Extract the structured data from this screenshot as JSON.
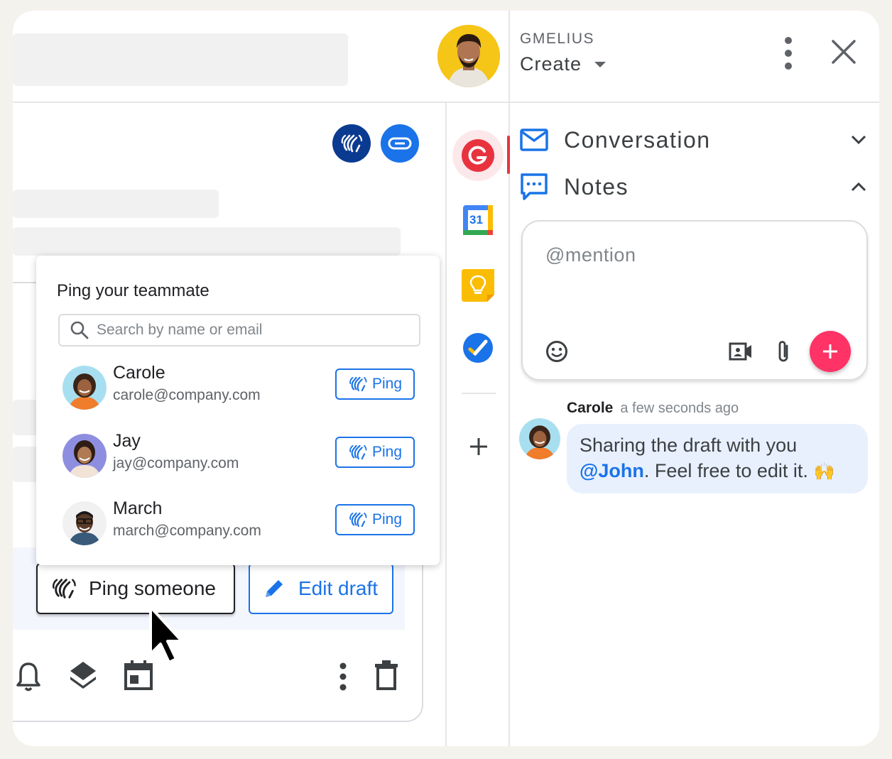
{
  "gmelius": {
    "brand": "GMELIUS",
    "create_label": "Create"
  },
  "popup": {
    "title": "Ping your teammate",
    "search_placeholder": "Search by name or email",
    "members": [
      {
        "name": "Carole",
        "email": "carole@company.com",
        "ping_label": "Ping"
      },
      {
        "name": "Jay",
        "email": "jay@company.com",
        "ping_label": "Ping"
      },
      {
        "name": "March",
        "email": "march@company.com",
        "ping_label": "Ping"
      }
    ]
  },
  "actions": {
    "ping_someone": "Ping someone",
    "edit_draft": "Edit draft"
  },
  "side_panel": {
    "conversation_label": "Conversation",
    "notes_label": "Notes",
    "mention_placeholder": "@mention"
  },
  "note": {
    "author": "Carole",
    "time": "a few seconds ago",
    "text_before": "Sharing the draft with you ",
    "mention": "@John",
    "text_after": ". Feel free to edit it.",
    "emoji": "🙌"
  },
  "calendar_day": "31",
  "colors": {
    "accent_blue": "#1a73e8",
    "fab_pink": "#ff3366",
    "gmelius_red": "#e8333f",
    "bubble_bg": "#e8f0fe"
  }
}
